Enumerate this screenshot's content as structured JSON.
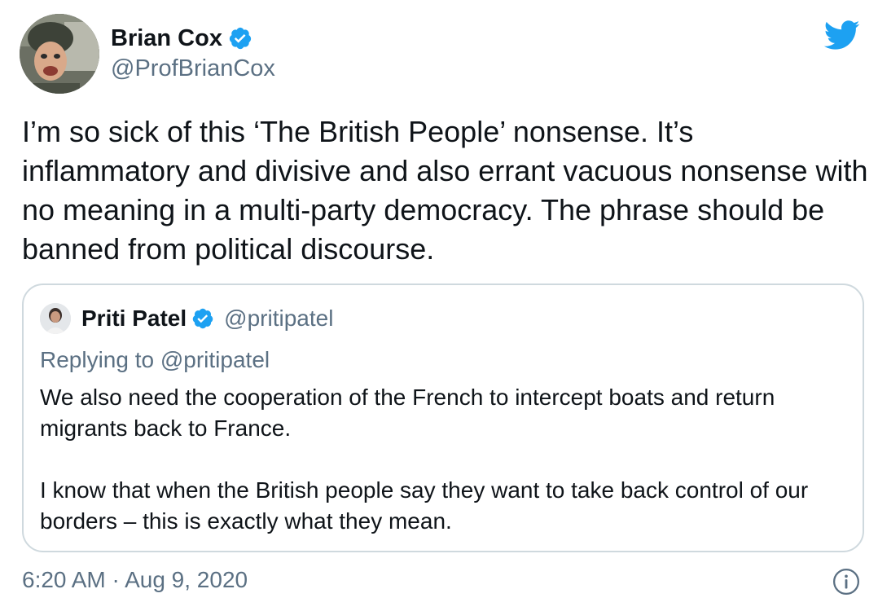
{
  "author": {
    "name": "Brian Cox",
    "handle": "@ProfBrianCox",
    "verified": true
  },
  "icons": {
    "brand": "twitter-bird-icon",
    "verified": "verified-badge-icon",
    "info": "info-icon"
  },
  "colors": {
    "twitter_blue": "#1DA1F2",
    "secondary_text": "#5B7083",
    "border": "#CFD9DE"
  },
  "tweet": {
    "text": "I’m so sick of this ‘The British People’ nonsense. It’s inflammatory and divisive and also errant vacuous nonsense with no meaning in a multi-party democracy. The phrase should be banned from political discourse.",
    "timestamp": "6:20 AM · Aug 9, 2020"
  },
  "quoted": {
    "name": "Priti Patel",
    "handle": "@pritipatel",
    "verified": true,
    "replying_to": "Replying to @pritipatel",
    "paragraphs": [
      "We also need the cooperation of the French to intercept boats and return migrants back to France.",
      "I know that when the British people say they want to take back control of our borders – this is exactly what they mean."
    ]
  }
}
